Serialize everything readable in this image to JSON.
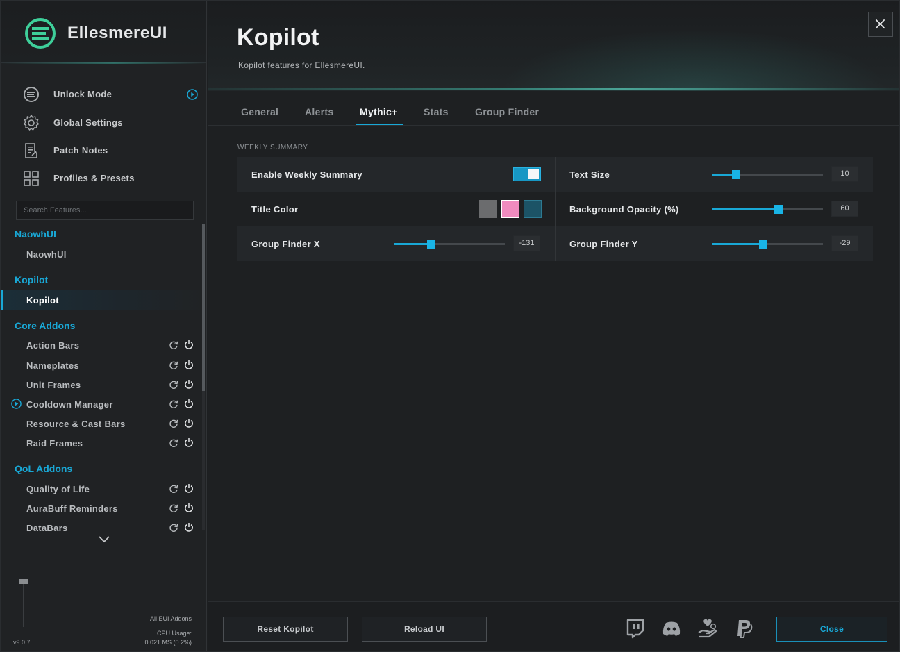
{
  "app": {
    "name": "EllesmereUI",
    "version": "v9.0.7",
    "accent": "#19a8d6",
    "brand_green": "#3ecf9a"
  },
  "sidebar": {
    "top_nav": [
      {
        "label": "Unlock Mode",
        "icon": "unlock-mode-icon"
      },
      {
        "label": "Global Settings",
        "icon": "gear-icon"
      },
      {
        "label": "Patch Notes",
        "icon": "document-icon"
      },
      {
        "label": "Profiles & Presets",
        "icon": "grid-icon"
      }
    ],
    "search_placeholder": "Search Features...",
    "sections": [
      {
        "title": "NaowhUI",
        "items": [
          {
            "label": "NaowhUI"
          }
        ]
      },
      {
        "title": "Kopilot",
        "items": [
          {
            "label": "Kopilot",
            "active": true
          }
        ]
      },
      {
        "title": "Core Addons",
        "items": [
          {
            "label": "Action Bars"
          },
          {
            "label": "Nameplates"
          },
          {
            "label": "Unit Frames"
          },
          {
            "label": "Cooldown Manager"
          },
          {
            "label": "Resource & Cast Bars"
          },
          {
            "label": "Raid Frames"
          }
        ]
      },
      {
        "title": "QoL Addons",
        "items": [
          {
            "label": "Quality of Life"
          },
          {
            "label": "AuraBuff Reminders"
          },
          {
            "label": "DataBars"
          }
        ]
      }
    ],
    "footer": {
      "all_addons": "All EUI Addons",
      "cpu_label": "CPU Usage:",
      "cpu_value": "0.021 MS (0.2%)"
    }
  },
  "main": {
    "title": "Kopilot",
    "subtitle": "Kopilot features for EllesmereUI.",
    "tabs": [
      {
        "label": "General"
      },
      {
        "label": "Alerts"
      },
      {
        "label": "Mythic+",
        "active": true
      },
      {
        "label": "Stats"
      },
      {
        "label": "Group Finder"
      }
    ],
    "section_label": "WEEKLY SUMMARY",
    "settings": {
      "enable_weekly_summary": {
        "label": "Enable Weekly Summary",
        "value": true
      },
      "title_color": {
        "label": "Title Color",
        "swatches": [
          "#6b6c6e",
          "#f08bbf",
          "#1c5366"
        ]
      },
      "group_finder_x": {
        "label": "Group Finder X",
        "value": "-131",
        "fraction": 0.34
      },
      "text_size": {
        "label": "Text Size",
        "value": "10",
        "fraction": 0.22
      },
      "background_opacity": {
        "label": "Background Opacity (%)",
        "value": "60",
        "fraction": 0.6
      },
      "group_finder_y": {
        "label": "Group Finder Y",
        "value": "-29",
        "fraction": 0.46
      }
    }
  },
  "footer": {
    "reset_label": "Reset Kopilot",
    "reload_label": "Reload UI",
    "close_label": "Close",
    "social_icons": [
      "twitch-icon",
      "discord-icon",
      "donate-hand-icon",
      "paypal-icon"
    ]
  }
}
